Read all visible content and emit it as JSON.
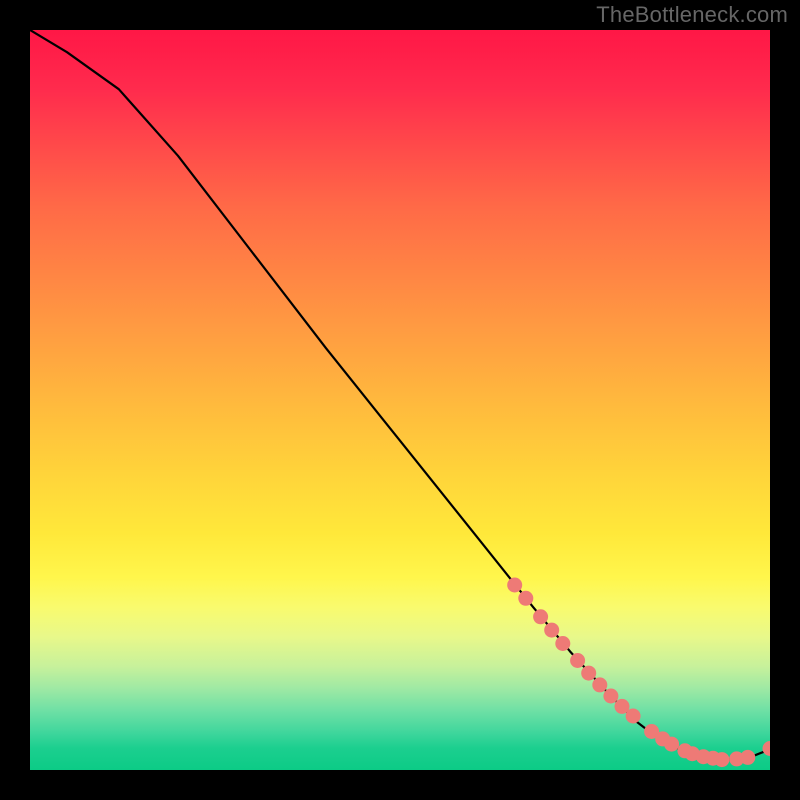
{
  "watermark": "TheBottleneck.com",
  "chart_data": {
    "type": "line",
    "title": "",
    "xlabel": "",
    "ylabel": "",
    "xlim": [
      0,
      100
    ],
    "ylim": [
      0,
      100
    ],
    "series": [
      {
        "name": "curve",
        "x": [
          0,
          5,
          12,
          20,
          30,
          40,
          50,
          60,
          68,
          73,
          78,
          82,
          85,
          88,
          91,
          94,
          97,
          100
        ],
        "y": [
          100,
          97,
          92,
          83,
          70,
          57,
          44.5,
          32,
          22,
          16,
          10.5,
          6.5,
          4.2,
          2.7,
          1.8,
          1.4,
          1.6,
          2.8
        ]
      }
    ],
    "markers": [
      {
        "x": 65.5,
        "y": 25.0
      },
      {
        "x": 67.0,
        "y": 23.2
      },
      {
        "x": 69.0,
        "y": 20.7
      },
      {
        "x": 70.5,
        "y": 18.9
      },
      {
        "x": 72.0,
        "y": 17.1
      },
      {
        "x": 74.0,
        "y": 14.8
      },
      {
        "x": 75.5,
        "y": 13.1
      },
      {
        "x": 77.0,
        "y": 11.5
      },
      {
        "x": 78.5,
        "y": 10.0
      },
      {
        "x": 80.0,
        "y": 8.6
      },
      {
        "x": 81.5,
        "y": 7.3
      },
      {
        "x": 84.0,
        "y": 5.2
      },
      {
        "x": 85.5,
        "y": 4.2
      },
      {
        "x": 86.7,
        "y": 3.5
      },
      {
        "x": 88.5,
        "y": 2.6
      },
      {
        "x": 89.5,
        "y": 2.2
      },
      {
        "x": 91.0,
        "y": 1.8
      },
      {
        "x": 92.3,
        "y": 1.6
      },
      {
        "x": 93.5,
        "y": 1.4
      },
      {
        "x": 95.5,
        "y": 1.5
      },
      {
        "x": 97.0,
        "y": 1.7
      },
      {
        "x": 100.0,
        "y": 2.9
      }
    ],
    "marker_color": "#ee7a76",
    "curve_color": "#000000"
  }
}
